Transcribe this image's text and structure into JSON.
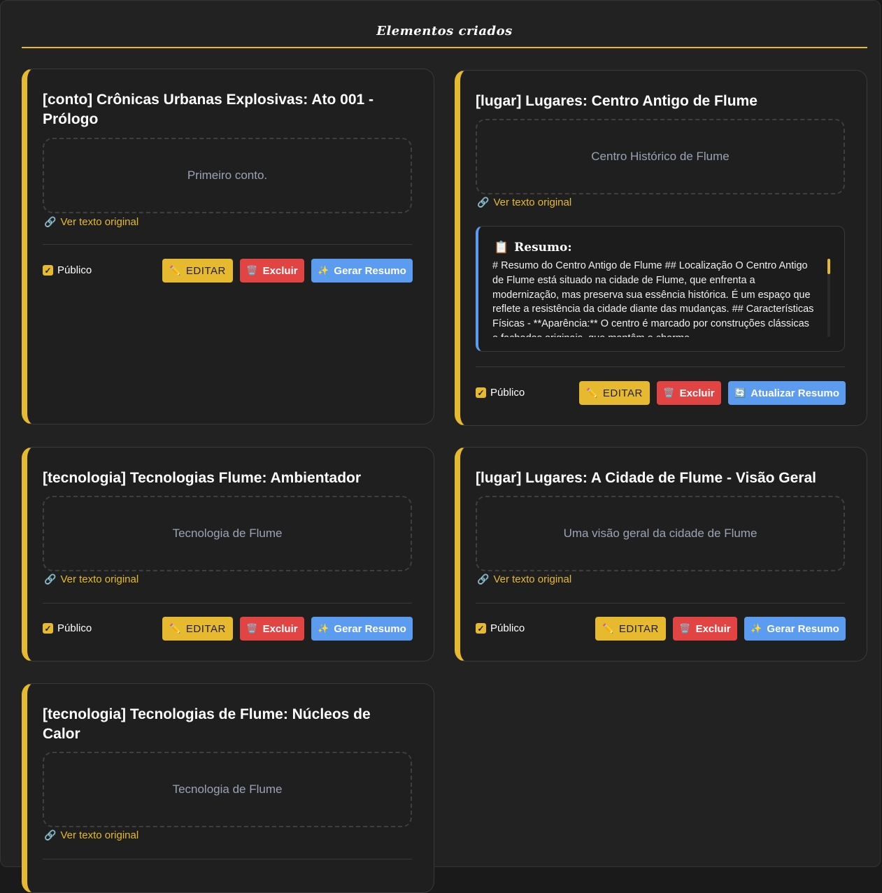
{
  "page": {
    "title": "Elementos criados"
  },
  "labels": {
    "original_link": "Ver texto original",
    "public": "Público",
    "edit": "EDITAR",
    "delete": "Excluir",
    "generate_summary": "Gerar Resumo",
    "update_summary": "Atualizar Resumo",
    "summary_heading": "Resumo:"
  },
  "cards": [
    {
      "title": "[conto] Crônicas Urbanas Explosivas: Ato 001 - Prólogo",
      "description": "Primeiro conto.",
      "public": true
    },
    {
      "title": "[lugar] Lugares: Centro Antigo de Flume",
      "description": "Centro Histórico de Flume",
      "public": true,
      "summary": "# Resumo do Centro Antigo de Flume ## Localização O Centro Antigo de Flume está situado na cidade de Flume, que enfrenta a modernização, mas preserva sua essência histórica. É um espaço que reflete a resistência da cidade diante das mudanças. ## Características Físicas - **Aparência:** O centro é marcado por construções clássicas e fachadas originais, que mantêm o charme"
    },
    {
      "title": "[tecnologia] Tecnologias Flume: Ambientador",
      "description": "Tecnologia de Flume",
      "public": true
    },
    {
      "title": "[lugar] Lugares: A Cidade de Flume - Visão Geral",
      "description": "Uma visão geral da cidade de Flume",
      "public": true
    },
    {
      "title": "[tecnologia] Tecnologias de Flume: Núcleos de Calor",
      "description": "Tecnologia de Flume",
      "public": true
    }
  ],
  "colors": {
    "accent": "#e6b92e",
    "danger": "#e24444",
    "info": "#5b9cf0"
  }
}
